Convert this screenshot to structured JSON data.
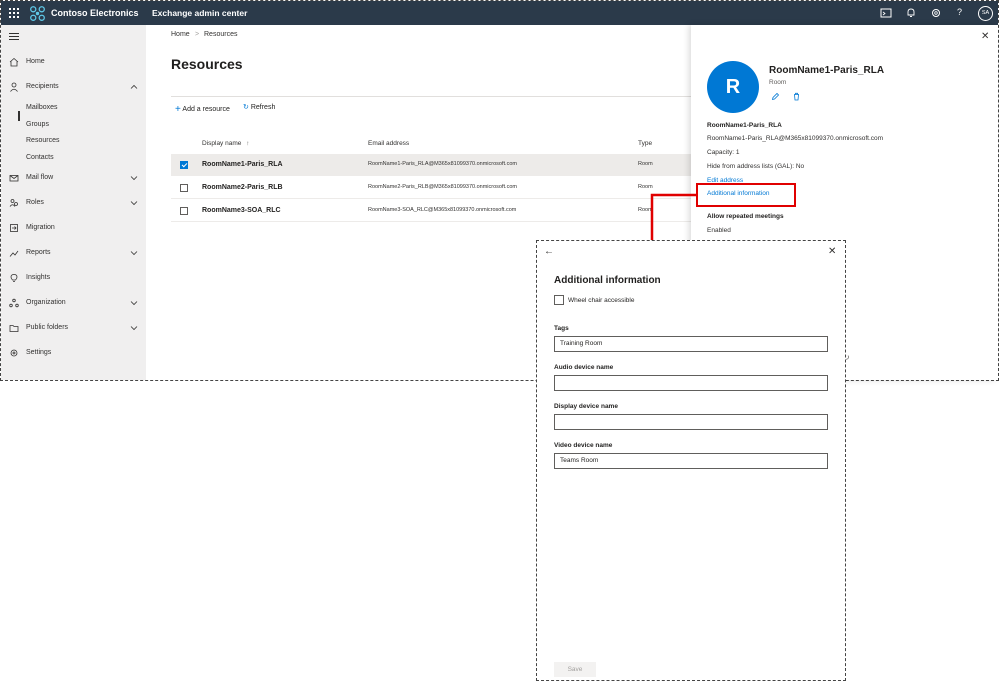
{
  "topbar": {
    "brand": "Contoso Electronics",
    "app_name": "Exchange admin center",
    "user_initials": "SA"
  },
  "nav": {
    "items": [
      {
        "label": "Home",
        "icon": "home-icon"
      },
      {
        "label": "Recipients",
        "icon": "person-icon"
      },
      {
        "label": "Mail flow",
        "icon": "mail-icon"
      },
      {
        "label": "Roles",
        "icon": "roles-icon"
      },
      {
        "label": "Migration",
        "icon": "migration-icon"
      },
      {
        "label": "Reports",
        "icon": "chart-icon"
      },
      {
        "label": "Insights",
        "icon": "lightbulb-icon"
      },
      {
        "label": "Organization",
        "icon": "org-icon"
      },
      {
        "label": "Public folders",
        "icon": "folder-icon"
      },
      {
        "label": "Settings",
        "icon": "gear-icon"
      }
    ],
    "recipients_sub": [
      "Mailboxes",
      "Groups",
      "Resources",
      "Contacts"
    ],
    "selected": "Resources"
  },
  "breadcrumb": {
    "home": "Home",
    "separator": ">",
    "current": "Resources"
  },
  "page_title": "Resources",
  "toolbar": {
    "add_label": "Add a resource",
    "refresh_label": "Refresh"
  },
  "table": {
    "columns": [
      "Display name",
      "Email address",
      "Type"
    ],
    "sort_indicator": "↑",
    "rows": [
      {
        "name": "RoomName1-Paris_RLA",
        "email": "RoomName1-Paris_RLA@M365x81099370.onmicrosoft.com",
        "type": "Room",
        "checked": true
      },
      {
        "name": "RoomName2-Paris_RLB",
        "email": "RoomName2-Paris_RLB@M365x81099370.onmicrosoft.com",
        "type": "Room",
        "checked": false
      },
      {
        "name": "RoomName3-SOA_RLC",
        "email": "RoomName3-SOA_RLC@M365x81099370.onmicrosoft.com",
        "type": "Room",
        "checked": false
      }
    ]
  },
  "panel": {
    "avatar_letter": "R",
    "title": "RoomName1-Paris_RLA",
    "subtitle": "Room",
    "name": "RoomName1-Paris_RLA",
    "email": "RoomName1-Paris_RLA@M365x81099370.onmicrosoft.com",
    "capacity": "Capacity: 1",
    "hide": "Hide from address lists (GAL): No",
    "edit_address": "Edit address",
    "additional_info": "Additional information",
    "allow_heading": "Allow repeated meetings",
    "allow_value": "Enabled"
  },
  "dialog": {
    "title": "Additional information",
    "checkbox_label": "Wheel chair accessible",
    "fields": [
      {
        "label": "Tags",
        "value": "Training Room"
      },
      {
        "label": "Audio device name",
        "value": ""
      },
      {
        "label": "Display device name",
        "value": ""
      },
      {
        "label": "Video device name",
        "value": "Teams Room"
      }
    ],
    "save_label": "Save"
  },
  "colors": {
    "topbar": "#2b3a4a",
    "accent": "#0078d4",
    "highlight": "#e00000"
  }
}
